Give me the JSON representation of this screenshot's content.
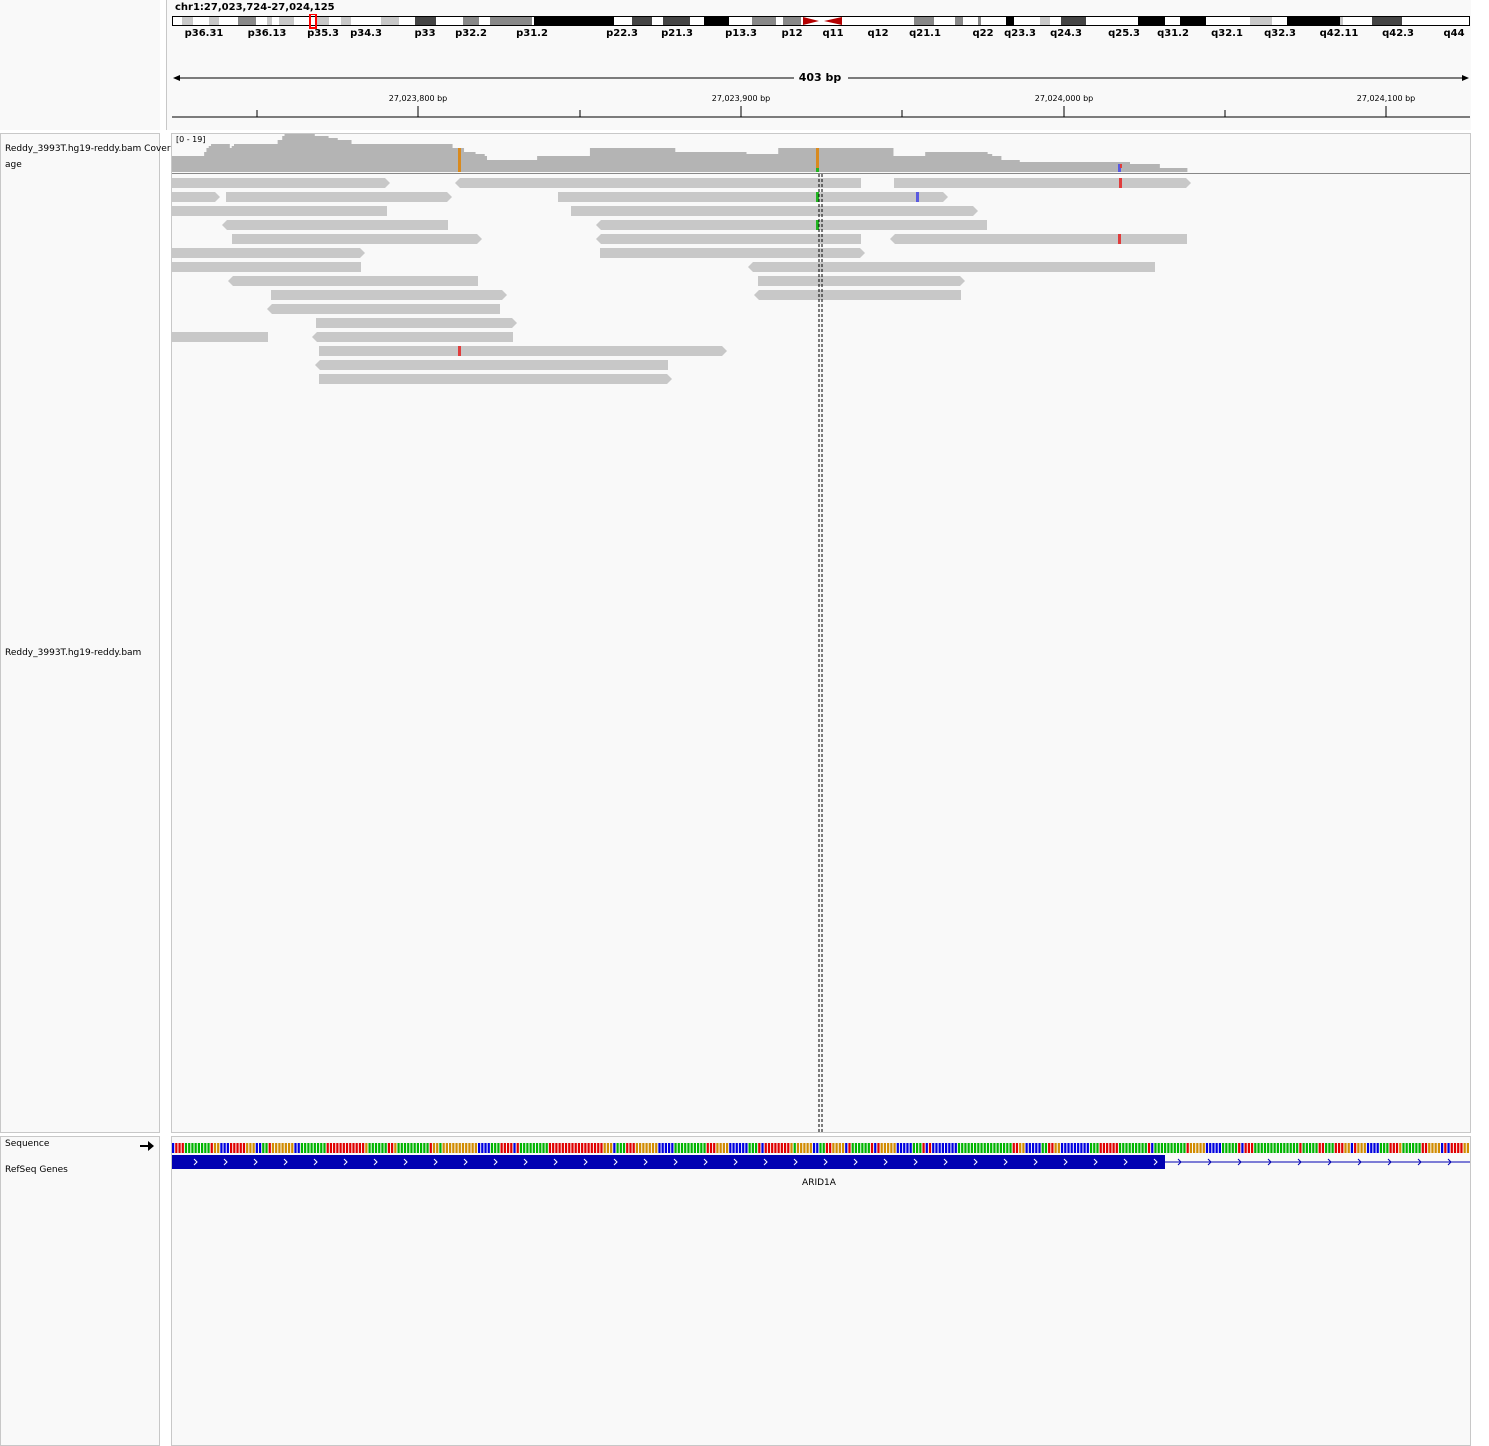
{
  "locus": "chr1:27,023,724-27,024,125",
  "span_label": "403 bp",
  "ruler_labels": [
    "27,023,800 bp",
    "27,023,900 bp",
    "27,024,000 bp",
    "27,024,100 bp"
  ],
  "bands": [
    "p36.31",
    "p36.13",
    "p35.3",
    "p34.3",
    "p33",
    "p32.2",
    "p31.2",
    "p22.3",
    "p21.3",
    "p13.3",
    "p12",
    "q11",
    "q12",
    "q21.1",
    "q22",
    "q23.3",
    "q24.3",
    "q25.3",
    "q31.2",
    "q32.1",
    "q32.3",
    "q42.11",
    "q42.3",
    "q44"
  ],
  "coverage": {
    "track_label": "Reddy_3993T.hg19-reddy.bam Coverage",
    "range": "[0 - 19]"
  },
  "alignment": {
    "track_label": "Reddy_3993T.hg19-reddy.bam"
  },
  "sequence": {
    "track_label": "Sequence",
    "strand_icon": "right-arrow-icon"
  },
  "genes": {
    "track_label": "RefSeq Genes",
    "gene_name": "ARID1A"
  },
  "colors": {
    "read": "#c8c8c8",
    "coverage": "#b4b4b4",
    "gene": "#0000b2",
    "mismatch_red": "#e03c3c",
    "mismatch_green": "#22b422",
    "mismatch_blue": "#5a5ae0",
    "mismatch_orange": "#d98a1e",
    "base_A": "#00b400",
    "base_C": "#0000e0",
    "base_G": "#d18b00",
    "base_T": "#e00000"
  }
}
